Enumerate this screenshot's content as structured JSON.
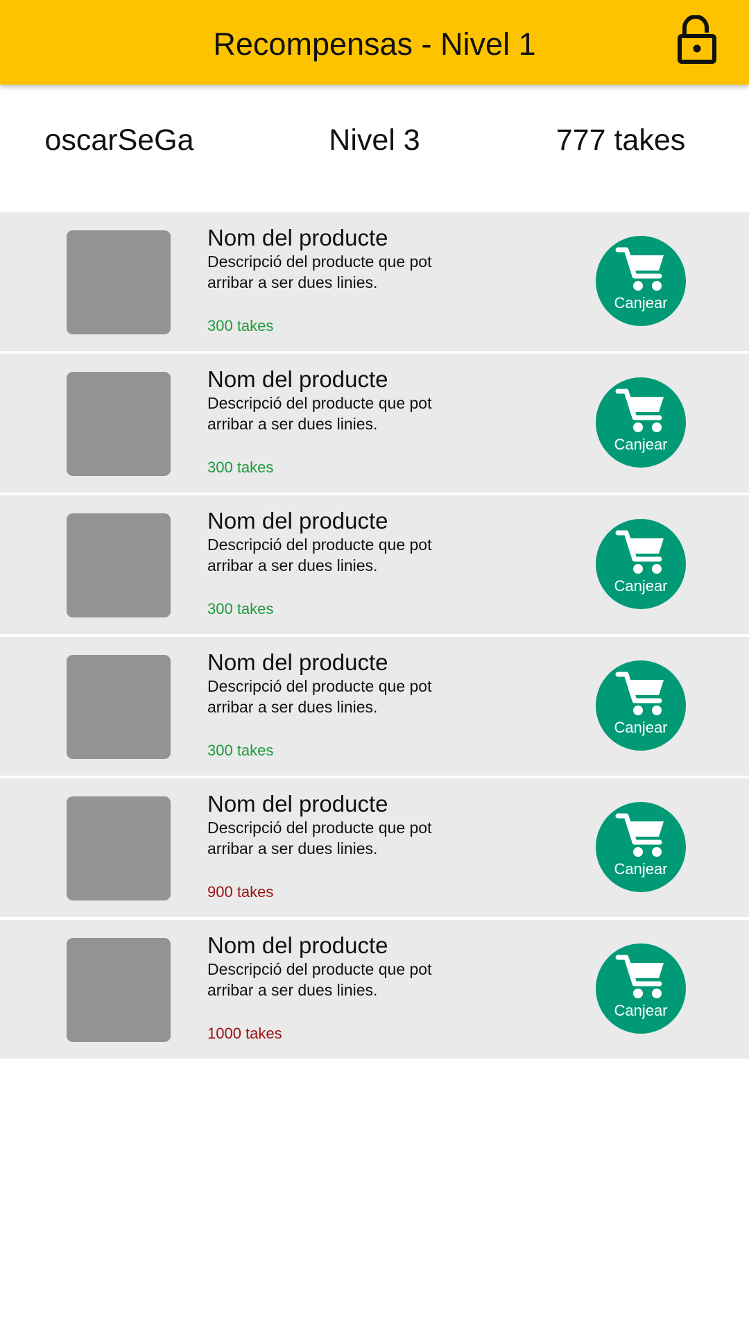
{
  "header": {
    "title": "Recompensas - Nivel 1",
    "lock_icon": "unlocked-padlock-icon",
    "background_color": "#fdc300"
  },
  "user": {
    "name": "oscarSeGa",
    "level": "Nivel 3",
    "takes": "777 takes"
  },
  "colors": {
    "row_background": "#eaeaea",
    "thumbnail": "#939393",
    "button": "#009a77",
    "affordable_price": "#1d9a3c",
    "unaffordable_price": "#9a1111"
  },
  "products": [
    {
      "name": "Nom del producte",
      "description": "Descripció del producte que pot arribar a ser dues linies.",
      "price": "300 takes",
      "affordable": true,
      "button_label": "Canjear",
      "button_icon": "shopping-cart-icon"
    },
    {
      "name": "Nom del producte",
      "description": "Descripció del producte que pot arribar a ser dues linies.",
      "price": "300 takes",
      "affordable": true,
      "button_label": "Canjear",
      "button_icon": "shopping-cart-icon"
    },
    {
      "name": "Nom del producte",
      "description": "Descripció del producte que pot arribar a ser dues linies.",
      "price": "300 takes",
      "affordable": true,
      "button_label": "Canjear",
      "button_icon": "shopping-cart-icon"
    },
    {
      "name": "Nom del producte",
      "description": "Descripció del producte que pot arribar a ser dues linies.",
      "price": "300 takes",
      "affordable": true,
      "button_label": "Canjear",
      "button_icon": "shopping-cart-icon"
    },
    {
      "name": "Nom del producte",
      "description": "Descripció del producte que pot arribar a ser dues linies.",
      "price": "900 takes",
      "affordable": false,
      "button_label": "Canjear",
      "button_icon": "shopping-cart-icon"
    },
    {
      "name": "Nom del producte",
      "description": "Descripció del producte que pot arribar a ser dues linies.",
      "price": "1000 takes",
      "affordable": false,
      "button_label": "Canjear",
      "button_icon": "shopping-cart-icon"
    }
  ]
}
